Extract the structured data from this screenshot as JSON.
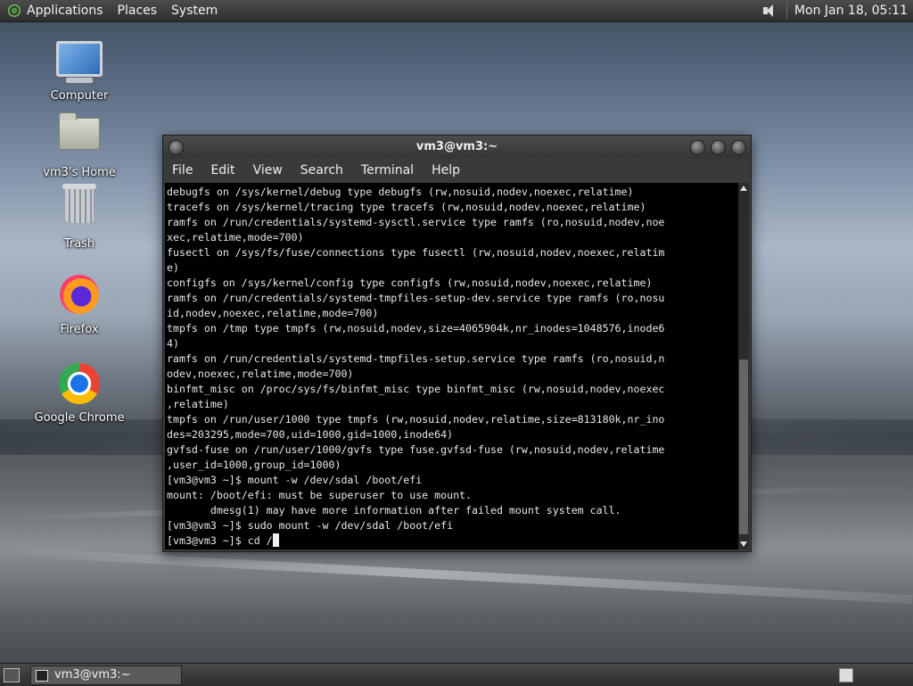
{
  "top_panel": {
    "menus": [
      "Applications",
      "Places",
      "System"
    ],
    "clock": "Mon Jan 18, 05:11"
  },
  "desktop": {
    "icons": [
      {
        "label": "Computer",
        "icon": "computer-icon"
      },
      {
        "label": "vm3's Home",
        "icon": "home-folder-icon"
      },
      {
        "label": "Trash",
        "icon": "trash-icon"
      },
      {
        "label": "Firefox",
        "icon": "firefox-icon"
      },
      {
        "label": "Google Chrome",
        "icon": "chrome-icon"
      }
    ]
  },
  "window": {
    "title": "vm3@vm3:~",
    "menu": [
      "File",
      "Edit",
      "View",
      "Search",
      "Terminal",
      "Help"
    ],
    "terminal_lines": [
      "debugfs on /sys/kernel/debug type debugfs (rw,nosuid,nodev,noexec,relatime)",
      "tracefs on /sys/kernel/tracing type tracefs (rw,nosuid,nodev,noexec,relatime)",
      "ramfs on /run/credentials/systemd-sysctl.service type ramfs (ro,nosuid,nodev,noe",
      "xec,relatime,mode=700)",
      "fusectl on /sys/fs/fuse/connections type fusectl (rw,nosuid,nodev,noexec,relatim",
      "e)",
      "configfs on /sys/kernel/config type configfs (rw,nosuid,nodev,noexec,relatime)",
      "ramfs on /run/credentials/systemd-tmpfiles-setup-dev.service type ramfs (ro,nosu",
      "id,nodev,noexec,relatime,mode=700)",
      "tmpfs on /tmp type tmpfs (rw,nosuid,nodev,size=4065904k,nr_inodes=1048576,inode6",
      "4)",
      "ramfs on /run/credentials/systemd-tmpfiles-setup.service type ramfs (ro,nosuid,n",
      "odev,noexec,relatime,mode=700)",
      "binfmt_misc on /proc/sys/fs/binfmt_misc type binfmt_misc (rw,nosuid,nodev,noexec",
      ",relatime)",
      "tmpfs on /run/user/1000 type tmpfs (rw,nosuid,nodev,relatime,size=813180k,nr_ino",
      "des=203295,mode=700,uid=1000,gid=1000,inode64)",
      "gvfsd-fuse on /run/user/1000/gvfs type fuse.gvfsd-fuse (rw,nosuid,nodev,relatime",
      ",user_id=1000,group_id=1000)",
      "[vm3@vm3 ~]$ mount -w /dev/sdal /boot/efi",
      "mount: /boot/efi: must be superuser to use mount.",
      "       dmesg(1) may have more information after failed mount system call.",
      "[vm3@vm3 ~]$ sudo mount -w /dev/sdal /boot/efi"
    ],
    "prompt_line": "[vm3@vm3 ~]$ cd /"
  },
  "taskbar": {
    "task_label": "vm3@vm3:~"
  }
}
